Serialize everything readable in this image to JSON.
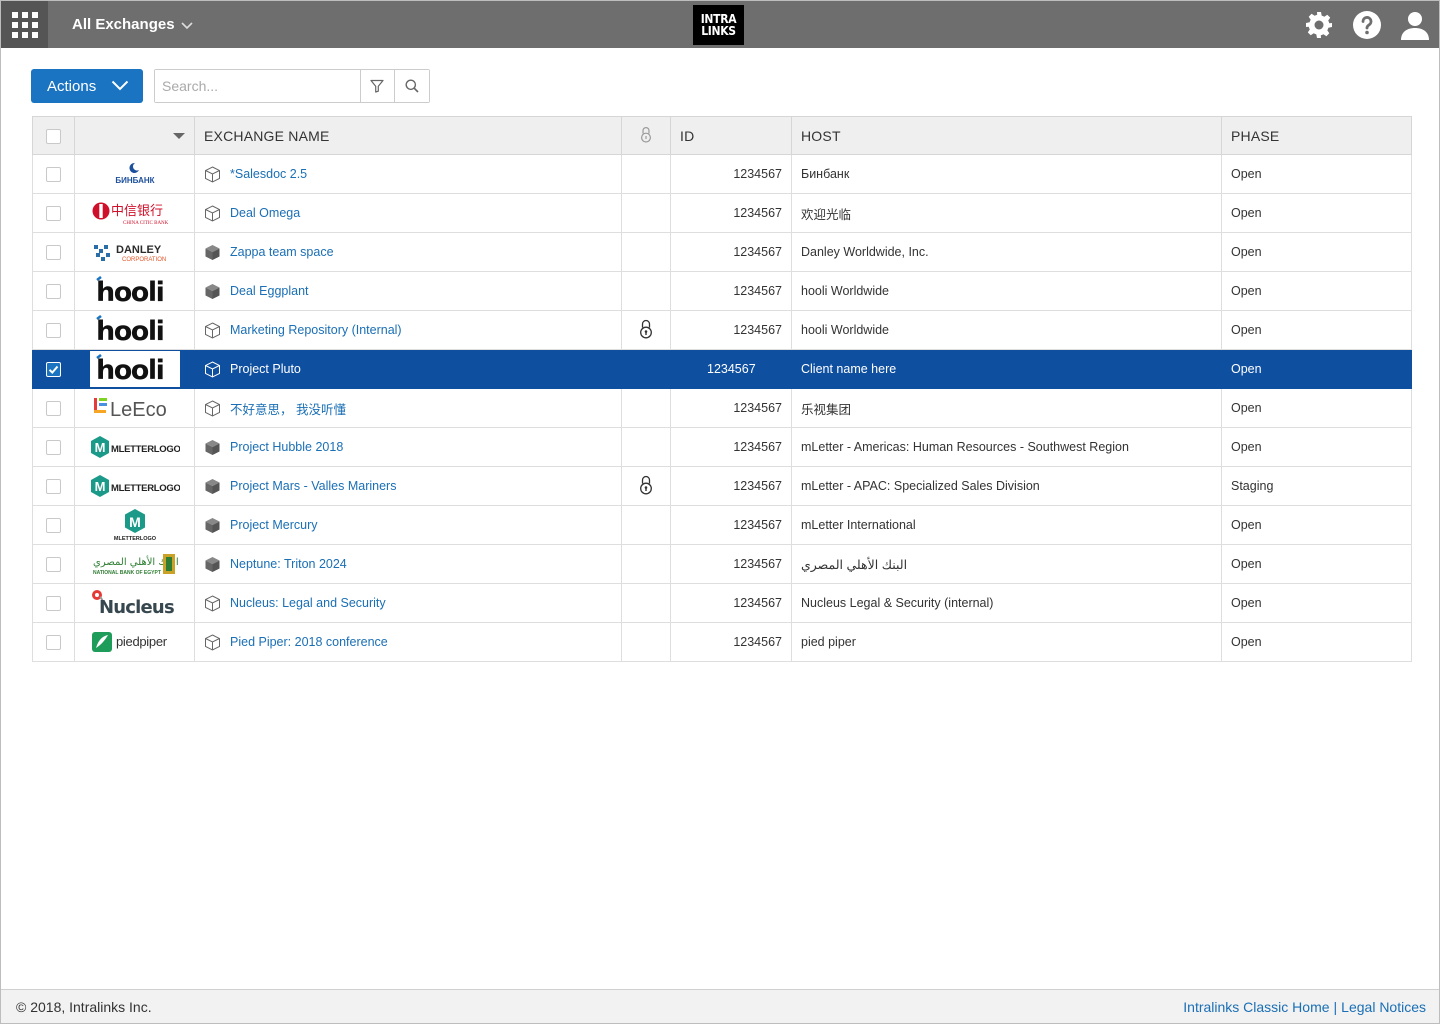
{
  "header": {
    "exchange_switcher": "All Exchanges",
    "brand_line1": "INTRA",
    "brand_line2": "LINKS"
  },
  "toolbar": {
    "actions_label": "Actions",
    "search_placeholder": "Search..."
  },
  "table": {
    "columns": {
      "name": "EXCHANGE NAME",
      "id": "ID",
      "host": "HOST",
      "phase": "PHASE"
    },
    "rows": [
      {
        "logo_text": "БИНБАНК",
        "name": "*Salesdoc 2.5",
        "id": "1234567",
        "host": "Бинбанк",
        "phase": "Open",
        "locked": false,
        "selected": false
      },
      {
        "logo_text": "中信银行",
        "logo_sub": "CHINA CITIC BANK",
        "name": "Deal Omega",
        "id": "1234567",
        "host": "欢迎光临",
        "phase": "Open",
        "locked": false,
        "selected": false
      },
      {
        "logo_text": "DANLEY",
        "logo_sub": "CORPORATION",
        "name": "Zappa team space",
        "id": "1234567",
        "host": "Danley Worldwide, Inc.",
        "phase": "Open",
        "locked": false,
        "selected": false
      },
      {
        "logo_text": "hooli",
        "name": "Deal Eggplant",
        "id": "1234567",
        "host": "hooli Worldwide",
        "phase": "Open",
        "locked": false,
        "selected": false
      },
      {
        "logo_text": "hooli",
        "name": "Marketing Repository (Internal)",
        "id": "1234567",
        "host": "hooli Worldwide",
        "phase": "Open",
        "locked": true,
        "selected": false
      },
      {
        "logo_text": "hooli",
        "name": "Project Pluto",
        "id": "1234567",
        "host": "Client name here",
        "phase": "Open",
        "locked": false,
        "selected": true
      },
      {
        "logo_text": "LeEco",
        "name": "不好意思， 我没听懂",
        "id": "1234567",
        "host": "乐视集团",
        "phase": "Open",
        "locked": false,
        "selected": false
      },
      {
        "logo_text": "MLETTERLOGO",
        "name": "Project Hubble 2018",
        "id": "1234567",
        "host": "mLetter - Americas: Human Resources - Southwest Region",
        "phase": "Open",
        "locked": false,
        "selected": false
      },
      {
        "logo_text": "MLETTERLOGO",
        "name": "Project Mars - Valles Mariners",
        "id": "1234567",
        "host": "mLetter - APAC: Specialized Sales Division",
        "phase": "Staging",
        "locked": true,
        "selected": false
      },
      {
        "logo_text": "MLETTERLOGO",
        "name": "Project Mercury",
        "id": "1234567",
        "host": "mLetter International",
        "phase": "Open",
        "locked": false,
        "selected": false
      },
      {
        "logo_text": "البنك الأهلي المصري",
        "logo_sub": "NATIONAL BANK OF EGYPT",
        "name": "Neptune: Triton 2024",
        "id": "1234567",
        "host": "البنك الأهلي المصري",
        "phase": "Open",
        "locked": false,
        "selected": false
      },
      {
        "logo_text": "Nucleus",
        "name": "Nucleus: Legal and Security",
        "id": "1234567",
        "host": "Nucleus Legal & Security (internal)",
        "phase": "Open",
        "locked": false,
        "selected": false
      },
      {
        "logo_text": "piedpiper",
        "name": "Pied Piper: 2018 conference",
        "id": "1234567",
        "host": "pied piper",
        "phase": "Open",
        "locked": false,
        "selected": false
      }
    ]
  },
  "footer": {
    "copyright": "© 2018, Intralinks Inc.",
    "classic_home": "Intralinks Classic Home",
    "separator": "|",
    "legal": "Legal Notices"
  },
  "colors": {
    "header_bg": "#6e6e6e",
    "accent": "#1a74c1",
    "selected_row": "#0f4fa0",
    "link": "#1a6fb5"
  }
}
